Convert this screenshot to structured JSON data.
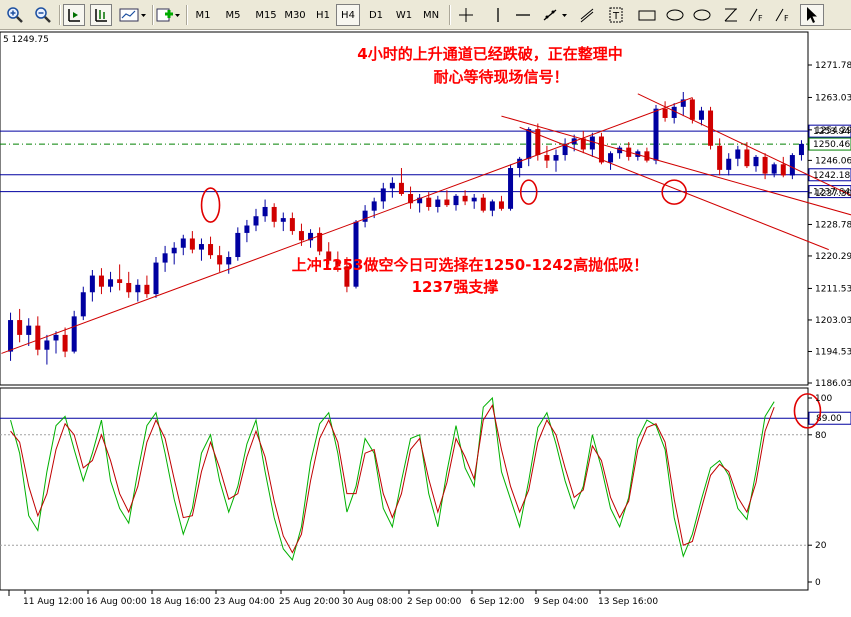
{
  "toolbar": {
    "timeframes": [
      "M1",
      "M5",
      "M15",
      "M30",
      "H1",
      "H4",
      "D1",
      "W1",
      "MN"
    ],
    "active_timeframe": "H4",
    "icons": [
      "zoom-in-icon",
      "zoom-out-icon",
      "chart-shift-icon",
      "autoscroll-icon",
      "chart-template-icon",
      "indicators-icon",
      "crosshair-icon",
      "vertical-line-icon",
      "horizontal-line-icon",
      "trendline-icon",
      "channel-icon",
      "fibonacci-icon",
      "text-icon",
      "shapes-icon",
      "arrow-icon",
      "cursor-icon"
    ]
  },
  "chart_header": "5 1249.75",
  "annotations": {
    "top_line1": "4小时的上升通道已经跌破，正在整理中",
    "top_line2": "耐心等待现场信号！",
    "mid_line1": "上冲1253做空今日可选择在1250-1242高抛低吸！",
    "mid_line2": "1237强支撑",
    "color": "#ff0000"
  },
  "price_axis": {
    "ticks": [
      "1271.78",
      "1263.03",
      "1254.29",
      "1246.06",
      "1237.30",
      "1228.78",
      "1220.29",
      "1211.53",
      "1203.03",
      "1194.53",
      "1186.03"
    ],
    "tick_values": [
      1271.78,
      1263.03,
      1254.29,
      1246.06,
      1237.3,
      1228.78,
      1220.29,
      1211.53,
      1203.03,
      1194.53,
      1186.03
    ],
    "levels": [
      {
        "label": "1253.94",
        "value": 1253.94,
        "style": "solid",
        "color": "#0000a0"
      },
      {
        "label": "1250.46",
        "value": 1250.46,
        "style": "current",
        "color": "#008000"
      },
      {
        "label": "1242.18",
        "value": 1242.18,
        "style": "solid",
        "color": "#0000a0"
      },
      {
        "label": "1237.64",
        "value": 1237.64,
        "style": "solid",
        "color": "#0000a0"
      }
    ]
  },
  "indicator_axis": {
    "ticks": [
      "100",
      "80",
      "20",
      "0"
    ],
    "tick_values": [
      100,
      80,
      20,
      0
    ],
    "level_label": "89.00",
    "level_value": 89
  },
  "time_axis": [
    "11 Aug 12:00",
    "16 Aug 00:00",
    "18 Aug 16:00",
    "23 Aug 04:00",
    "25 Aug 20:00",
    "30 Aug 08:00",
    "2 Sep 00:00",
    "6 Sep 12:00",
    "9 Sep 04:00",
    "13 Sep 16:00"
  ],
  "colors": {
    "bull": "#0000a0",
    "bear": "#d00000",
    "channel": "#d00000",
    "k_line": "#00b000",
    "d_line": "#c00000"
  },
  "chart_data": {
    "type": "candlestick",
    "symbol_price": 1249.75,
    "ylim": [
      1186.03,
      1271.78
    ],
    "candles": [
      [
        1194.5,
        1205.0,
        1192.0,
        1203.0
      ],
      [
        1203.0,
        1206.0,
        1197.0,
        1199.0
      ],
      [
        1199.0,
        1203.5,
        1196.0,
        1201.5
      ],
      [
        1201.5,
        1204.0,
        1193.5,
        1195.0
      ],
      [
        1195.0,
        1199.0,
        1191.0,
        1197.5
      ],
      [
        1197.5,
        1200.0,
        1194.0,
        1199.0
      ],
      [
        1199.0,
        1201.0,
        1193.0,
        1194.5
      ],
      [
        1194.5,
        1205.5,
        1194.0,
        1204.0
      ],
      [
        1204.0,
        1212.0,
        1203.0,
        1210.5
      ],
      [
        1210.5,
        1216.5,
        1208.0,
        1215.0
      ],
      [
        1215.0,
        1217.0,
        1210.0,
        1212.0
      ],
      [
        1212.0,
        1216.0,
        1210.5,
        1214.0
      ],
      [
        1214.0,
        1218.0,
        1211.0,
        1213.0
      ],
      [
        1213.0,
        1216.0,
        1209.0,
        1210.5
      ],
      [
        1210.5,
        1214.0,
        1208.0,
        1212.5
      ],
      [
        1212.5,
        1215.0,
        1209.0,
        1210.0
      ],
      [
        1210.0,
        1220.0,
        1209.0,
        1218.5
      ],
      [
        1218.5,
        1223.0,
        1216.0,
        1221.0
      ],
      [
        1221.0,
        1224.0,
        1218.0,
        1222.5
      ],
      [
        1222.5,
        1226.0,
        1220.5,
        1225.0
      ],
      [
        1225.0,
        1227.0,
        1221.0,
        1222.0
      ],
      [
        1222.0,
        1225.0,
        1219.0,
        1223.5
      ],
      [
        1223.5,
        1225.5,
        1219.5,
        1220.5
      ],
      [
        1220.5,
        1223.0,
        1216.0,
        1218.0
      ],
      [
        1218.0,
        1221.5,
        1215.5,
        1220.0
      ],
      [
        1220.0,
        1228.0,
        1219.0,
        1226.5
      ],
      [
        1226.5,
        1230.0,
        1224.0,
        1228.5
      ],
      [
        1228.5,
        1233.0,
        1227.0,
        1231.0
      ],
      [
        1231.0,
        1235.5,
        1229.5,
        1233.5
      ],
      [
        1233.5,
        1234.5,
        1228.0,
        1229.5
      ],
      [
        1229.5,
        1232.0,
        1227.0,
        1230.5
      ],
      [
        1230.5,
        1232.0,
        1226.0,
        1227.0
      ],
      [
        1227.0,
        1229.0,
        1223.0,
        1224.5
      ],
      [
        1224.5,
        1227.5,
        1222.5,
        1226.5
      ],
      [
        1226.5,
        1228.0,
        1220.5,
        1221.5
      ],
      [
        1221.5,
        1224.0,
        1218.0,
        1219.0
      ],
      [
        1219.0,
        1221.5,
        1216.0,
        1217.5
      ],
      [
        1217.5,
        1220.0,
        1210.5,
        1212.0
      ],
      [
        1212.0,
        1230.0,
        1211.5,
        1229.5
      ],
      [
        1229.5,
        1234.0,
        1228.0,
        1232.5
      ],
      [
        1232.5,
        1236.0,
        1230.5,
        1235.0
      ],
      [
        1235.0,
        1240.0,
        1233.0,
        1238.5
      ],
      [
        1238.5,
        1241.5,
        1236.0,
        1240.0
      ],
      [
        1240.0,
        1244.0,
        1236.5,
        1237.0
      ],
      [
        1237.0,
        1239.0,
        1233.0,
        1234.5
      ],
      [
        1234.5,
        1237.0,
        1232.0,
        1236.0
      ],
      [
        1236.0,
        1237.5,
        1232.5,
        1233.5
      ],
      [
        1233.5,
        1236.5,
        1232.0,
        1235.5
      ],
      [
        1235.5,
        1238.0,
        1233.5,
        1234.0
      ],
      [
        1234.0,
        1237.0,
        1232.5,
        1236.5
      ],
      [
        1236.5,
        1238.0,
        1234.0,
        1235.0
      ],
      [
        1235.0,
        1237.0,
        1233.0,
        1236.0
      ],
      [
        1236.0,
        1237.0,
        1232.0,
        1232.5
      ],
      [
        1232.5,
        1235.5,
        1231.0,
        1235.0
      ],
      [
        1235.0,
        1236.5,
        1232.5,
        1233.0
      ],
      [
        1233.0,
        1245.0,
        1232.5,
        1244.0
      ],
      [
        1244.0,
        1247.0,
        1241.5,
        1246.5
      ],
      [
        1246.5,
        1255.0,
        1244.5,
        1254.5
      ],
      [
        1254.5,
        1256.0,
        1246.0,
        1247.5
      ],
      [
        1247.5,
        1250.0,
        1244.0,
        1246.0
      ],
      [
        1246.0,
        1249.0,
        1243.0,
        1247.5
      ],
      [
        1247.5,
        1252.0,
        1246.0,
        1250.5
      ],
      [
        1250.5,
        1253.0,
        1248.5,
        1252.0
      ],
      [
        1252.0,
        1254.0,
        1248.0,
        1249.0
      ],
      [
        1249.0,
        1253.5,
        1247.0,
        1252.5
      ],
      [
        1252.5,
        1253.5,
        1245.0,
        1245.5
      ],
      [
        1245.5,
        1248.5,
        1243.5,
        1248.0
      ],
      [
        1248.0,
        1250.0,
        1246.5,
        1249.5
      ],
      [
        1249.5,
        1251.0,
        1246.0,
        1247.0
      ],
      [
        1247.0,
        1249.0,
        1246.0,
        1248.5
      ],
      [
        1248.5,
        1249.5,
        1245.5,
        1246.0
      ],
      [
        1246.0,
        1261.0,
        1245.0,
        1260.0
      ],
      [
        1260.0,
        1262.0,
        1256.5,
        1257.5
      ],
      [
        1257.5,
        1261.5,
        1256.0,
        1260.5
      ],
      [
        1260.5,
        1264.5,
        1258.0,
        1262.5
      ],
      [
        1262.5,
        1263.0,
        1256.0,
        1257.0
      ],
      [
        1257.0,
        1260.5,
        1255.5,
        1259.5
      ],
      [
        1259.5,
        1260.5,
        1249.0,
        1250.0
      ],
      [
        1250.0,
        1252.0,
        1242.0,
        1243.5
      ],
      [
        1243.5,
        1248.0,
        1242.0,
        1246.5
      ],
      [
        1246.5,
        1250.0,
        1244.5,
        1249.0
      ],
      [
        1249.0,
        1251.0,
        1244.0,
        1244.5
      ],
      [
        1244.5,
        1247.5,
        1243.0,
        1247.0
      ],
      [
        1247.0,
        1248.0,
        1241.0,
        1242.5
      ],
      [
        1242.5,
        1245.5,
        1241.5,
        1245.0
      ],
      [
        1245.0,
        1247.0,
        1241.5,
        1242.0
      ],
      [
        1242.0,
        1248.0,
        1241.0,
        1247.5
      ],
      [
        1247.5,
        1251.5,
        1246.0,
        1250.5
      ]
    ],
    "stochastic_k": [
      88,
      70,
      36,
      28,
      60,
      85,
      90,
      72,
      55,
      70,
      88,
      55,
      40,
      32,
      60,
      85,
      92,
      70,
      45,
      26,
      40,
      70,
      80,
      55,
      38,
      52,
      75,
      88,
      60,
      35,
      18,
      12,
      30,
      65,
      86,
      92,
      70,
      38,
      52,
      78,
      70,
      40,
      30,
      55,
      78,
      80,
      48,
      30,
      60,
      85,
      62,
      52,
      95,
      100,
      60,
      45,
      30,
      55,
      84,
      92,
      75,
      55,
      40,
      52,
      80,
      62,
      40,
      30,
      46,
      78,
      88,
      85,
      72,
      35,
      14,
      26,
      45,
      62,
      66,
      58,
      40,
      34,
      60,
      90,
      98
    ],
    "stochastic_d": [
      82,
      76,
      52,
      36,
      48,
      72,
      86,
      80,
      62,
      66,
      80,
      66,
      48,
      38,
      52,
      76,
      88,
      78,
      56,
      35,
      36,
      60,
      76,
      62,
      45,
      48,
      68,
      82,
      68,
      44,
      25,
      16,
      26,
      55,
      78,
      88,
      76,
      48,
      48,
      70,
      72,
      48,
      35,
      48,
      72,
      78,
      56,
      38,
      54,
      78,
      68,
      56,
      88,
      96,
      72,
      52,
      38,
      50,
      76,
      88,
      80,
      62,
      46,
      50,
      74,
      66,
      46,
      35,
      44,
      72,
      84,
      86,
      76,
      45,
      20,
      22,
      40,
      58,
      64,
      60,
      46,
      38,
      54,
      82,
      95
    ]
  }
}
